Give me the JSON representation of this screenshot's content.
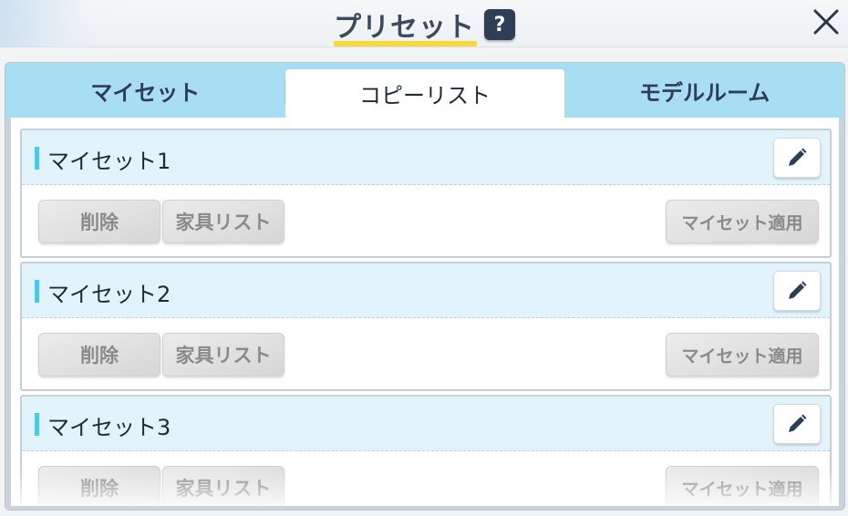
{
  "header": {
    "title": "プリセット",
    "help_label": "?"
  },
  "tabs": [
    {
      "label": "マイセット",
      "active": false
    },
    {
      "label": "コピーリスト",
      "active": true
    },
    {
      "label": "モデルルーム",
      "active": false
    }
  ],
  "cards": [
    {
      "name": "マイセット1",
      "delete_label": "削除",
      "furniture_label": "家具リスト",
      "apply_label": "マイセット適用"
    },
    {
      "name": "マイセット2",
      "delete_label": "削除",
      "furniture_label": "家具リスト",
      "apply_label": "マイセット適用"
    },
    {
      "name": "マイセット3",
      "delete_label": "削除",
      "furniture_label": "家具リスト",
      "apply_label": "マイセット適用"
    }
  ],
  "icons": {
    "close": "close-icon",
    "edit": "pencil-icon",
    "help": "question-icon"
  },
  "colors": {
    "accent_yellow": "#f5d93c",
    "tab_bg": "#a9ddf3",
    "card_head": "#e3f3fc",
    "marker": "#4fc6ec",
    "dark_navy": "#2e3e56"
  }
}
